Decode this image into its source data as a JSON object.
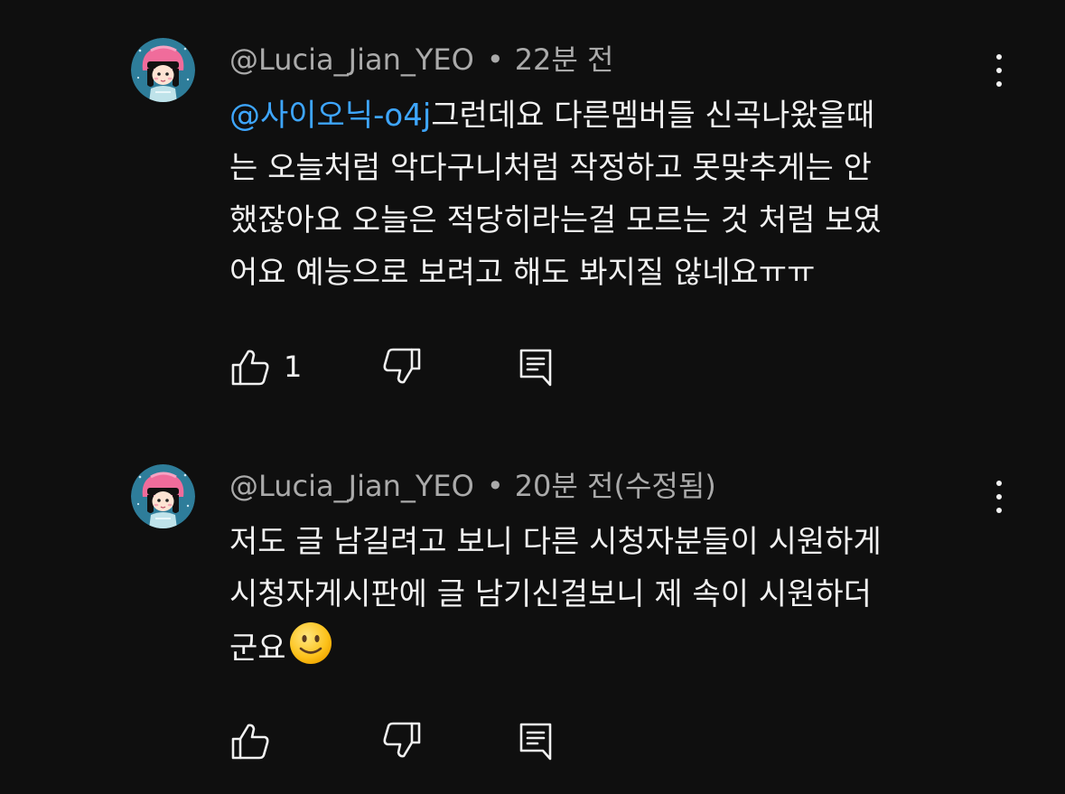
{
  "comments": [
    {
      "author": "@Lucia_Jian_YEO",
      "separator": "•",
      "time": "22분 전",
      "mention": "@사이오닉-o4j",
      "lines": [
        "그런데요 다른멤버들 신곡나왔을때",
        "는 오늘처럼 악다구니처럼 작정하고 못맞추게는 안",
        "했잖아요 오늘은 적당히라는걸 모르는 것 처럼 보였",
        "어요 예능으로 보려고 해도 봐지질 않네요ㅠㅠ"
      ],
      "like_count": "1",
      "icons": {
        "avatar": "avatar-icon",
        "like": "thumbs-up-icon",
        "dislike": "thumbs-down-icon",
        "reply": "reply-icon",
        "menu": "more-vertical-icon"
      }
    },
    {
      "author": "@Lucia_Jian_YEO",
      "separator": "•",
      "time": "20분 전(수정됨)",
      "lines": [
        "저도 글 남길려고 보니 다른 시청자분들이 시원하게",
        "시청자게시판에 글 남기신걸보니 제 속이 시원하더",
        "군요"
      ],
      "emoji": "slightly-smiling-face-emoji",
      "like_count": "",
      "icons": {
        "avatar": "avatar-icon",
        "like": "thumbs-up-icon",
        "dislike": "thumbs-down-icon",
        "reply": "reply-icon",
        "menu": "more-vertical-icon"
      }
    }
  ],
  "colors": {
    "background": "#0f0f0f",
    "text": "#f1f1f1",
    "meta": "#aaaaaa",
    "mention": "#3ea6ff"
  }
}
